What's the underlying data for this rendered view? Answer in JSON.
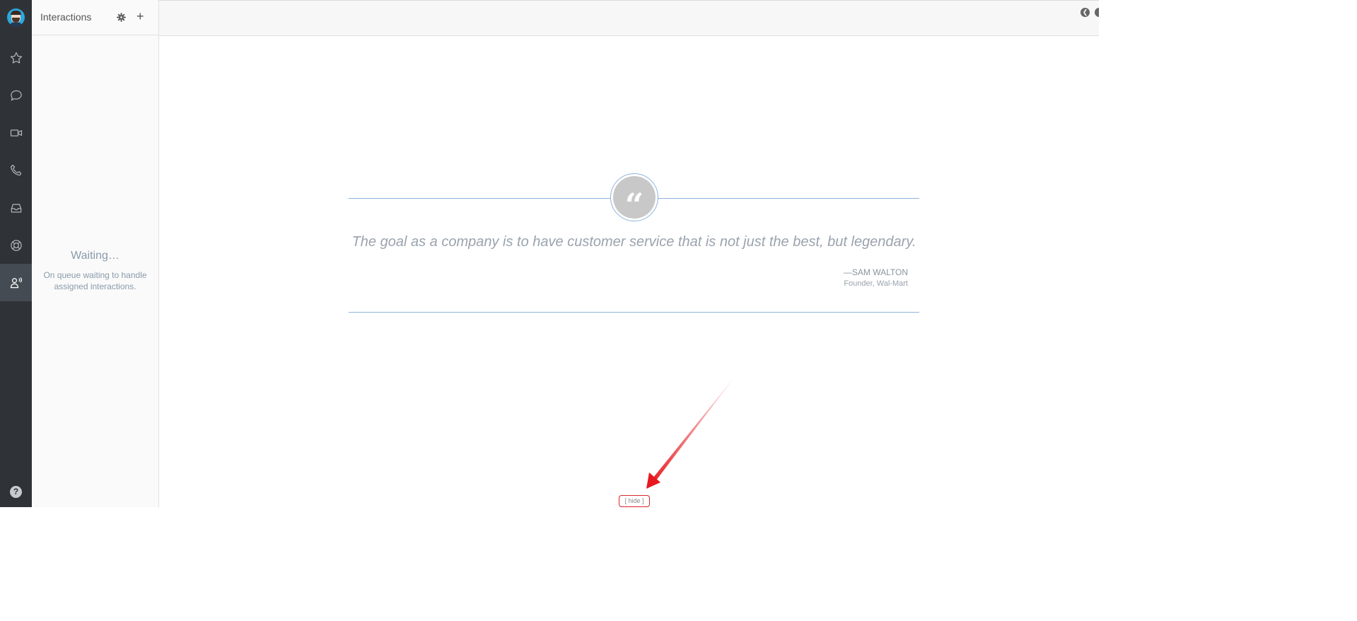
{
  "sidebar": {
    "items": [
      {
        "name": "favorites",
        "icon": "star-icon"
      },
      {
        "name": "chat",
        "icon": "chat-icon"
      },
      {
        "name": "video",
        "icon": "video-icon"
      },
      {
        "name": "phone",
        "icon": "phone-icon"
      },
      {
        "name": "inbox",
        "icon": "inbox-icon"
      },
      {
        "name": "support",
        "icon": "lifebuoy-icon"
      },
      {
        "name": "interactions",
        "icon": "agent-icon",
        "active": true
      }
    ],
    "help_label": "?"
  },
  "panel": {
    "title": "Interactions",
    "waiting_title": "Waiting…",
    "waiting_subtitle": "On queue waiting to handle assigned interactions."
  },
  "quote": {
    "text": "The goal as a company is to have customer service that is not just the best, but legendary.",
    "author": "—SAM WALTON",
    "role": "Founder, Wal-Mart"
  },
  "hide_button": {
    "label": "[ hide ]"
  },
  "colors": {
    "rail": "#2f3338",
    "accent_line": "#8fb3de",
    "annotation_red": "#e5191f"
  }
}
